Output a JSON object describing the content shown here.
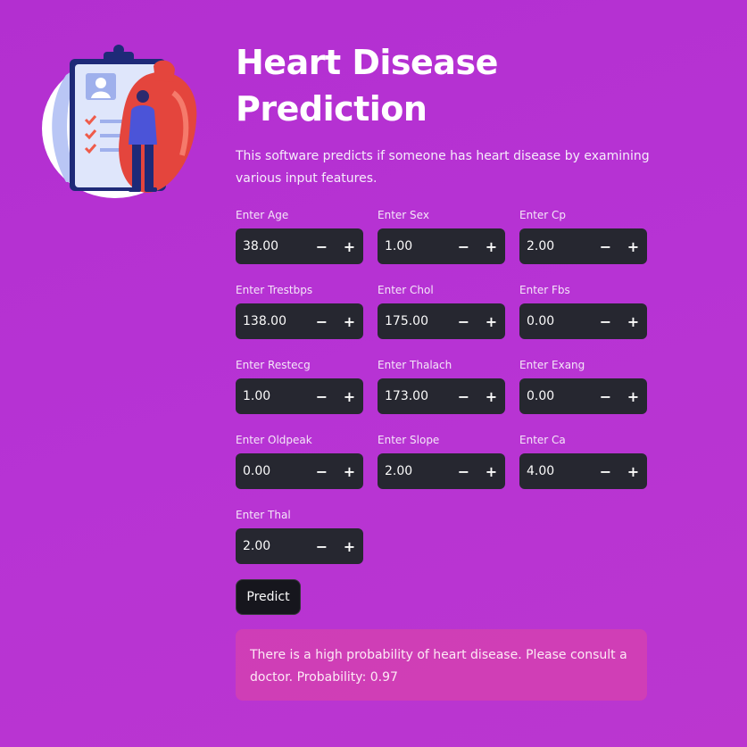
{
  "header": {
    "title": "Heart Disease Prediction",
    "description": "This software predicts if someone has heart disease by examining various input features."
  },
  "icons": {
    "decrement": "minus-icon",
    "increment": "plus-icon",
    "illustration": "heart-clipboard-doctor-illustration"
  },
  "fields": [
    {
      "label": "Enter Age",
      "value": "38.00"
    },
    {
      "label": "Enter Sex",
      "value": "1.00"
    },
    {
      "label": "Enter Cp",
      "value": "2.00"
    },
    {
      "label": "Enter Trestbps",
      "value": "138.00"
    },
    {
      "label": "Enter Chol",
      "value": "175.00"
    },
    {
      "label": "Enter Fbs",
      "value": "0.00"
    },
    {
      "label": "Enter Restecg",
      "value": "1.00"
    },
    {
      "label": "Enter Thalach",
      "value": "173.00"
    },
    {
      "label": "Enter Exang",
      "value": "0.00"
    },
    {
      "label": "Enter Oldpeak",
      "value": "0.00"
    },
    {
      "label": "Enter Slope",
      "value": "2.00"
    },
    {
      "label": "Enter Ca",
      "value": "4.00"
    },
    {
      "label": "Enter Thal",
      "value": "2.00"
    }
  ],
  "stepper": {
    "minus": "−",
    "plus": "+"
  },
  "predict_button": {
    "label": "Predict"
  },
  "result": {
    "message": "There is a high probability of heart disease. Please consult a doctor. Probability: 0.97"
  },
  "colors": {
    "background": "#b733d4",
    "input_bg": "#262730",
    "button_bg": "#16161d",
    "alert_bg": "#e146a0"
  }
}
